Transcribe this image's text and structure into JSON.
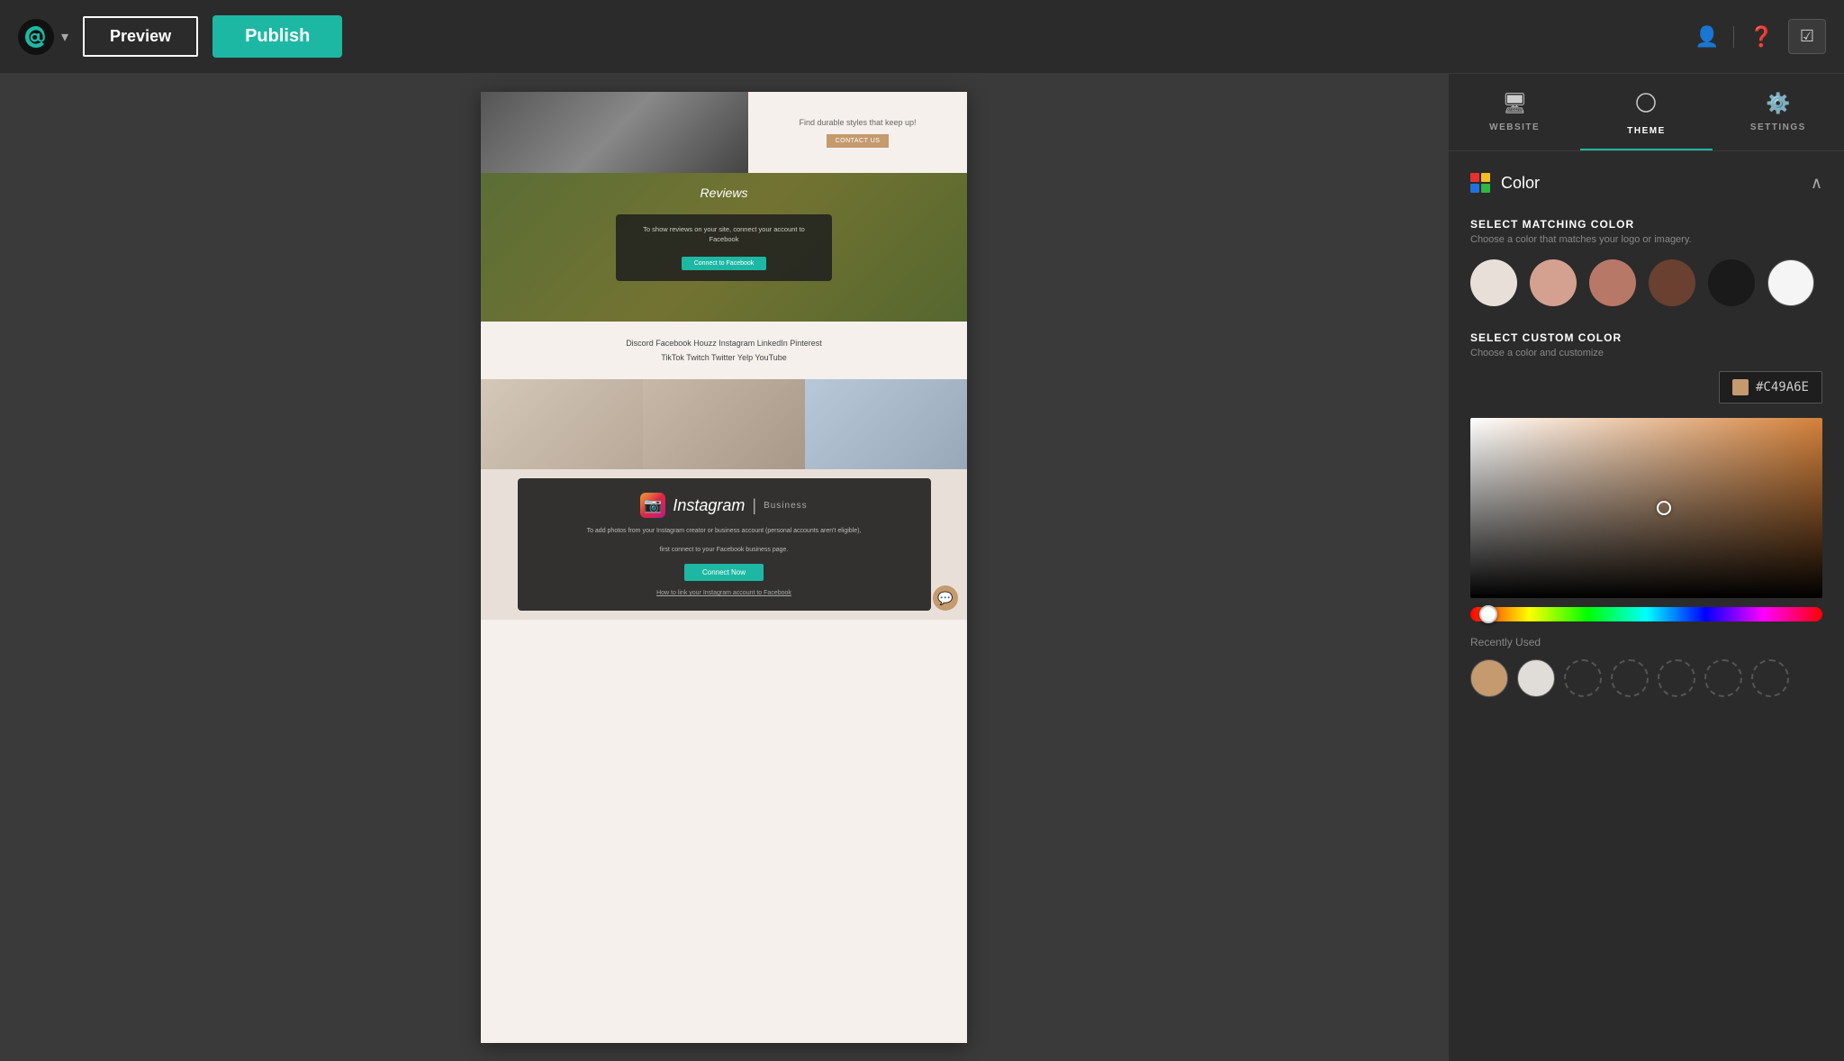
{
  "topbar": {
    "preview_label": "Preview",
    "publish_label": "Publish",
    "logo_alt": "GoDaddy"
  },
  "panel": {
    "tabs": [
      {
        "id": "website",
        "label": "WEBSITE",
        "icon": "🖥"
      },
      {
        "id": "theme",
        "label": "THEME",
        "icon": "◑"
      },
      {
        "id": "settings",
        "label": "SETTINGS",
        "icon": "⚙"
      }
    ],
    "active_tab": "theme",
    "color_section": {
      "title": "Color",
      "select_matching_label": "SELECT MATCHING COLOR",
      "select_matching_sub": "Choose a color that matches your logo or imagery.",
      "matching_colors": [
        "#e8e0d8",
        "#d4a090",
        "#b87868",
        "#6a4030",
        "#1a1a1a",
        "#f5f5f5"
      ],
      "select_custom_label": "SELECT CUSTOM COLOR",
      "select_custom_sub": "Choose a color and customize",
      "custom_hex": "#C49A6E",
      "custom_swatch_color": "#c49a6e",
      "gradient_cursor_left": "55%",
      "gradient_cursor_top": "50%",
      "hue_slider_left": "5%",
      "recently_used_label": "Recently Used",
      "recent_swatches": [
        {
          "color": "#c49a6e",
          "empty": false
        },
        {
          "color": "#e0ddd8",
          "empty": false
        },
        {
          "color": "",
          "empty": true
        },
        {
          "color": "",
          "empty": true
        },
        {
          "color": "",
          "empty": true
        },
        {
          "color": "",
          "empty": true
        },
        {
          "color": "",
          "empty": true
        }
      ]
    }
  },
  "preview": {
    "hero_text": "Find durable styles that keep up!",
    "contact_btn": "CONTACT US",
    "reviews_title": "Reviews",
    "reviews_card_text": "To show reviews on your site, connect your account to Facebook",
    "connect_fb_btn": "Connect to Facebook",
    "social_links_row1": "Discord    Facebook    Houzz    Instagram    LinkedIn    Pinterest",
    "social_links_row2": "TikTok    Twitch    Twitter    Yelp    YouTube",
    "insta_business": "Business",
    "insta_desc1": "To add photos from your Instagram creator or business account (personal accounts aren't eligible),",
    "insta_desc2": "first connect to your Facebook business page.",
    "connect_now_btn": "Connect Now",
    "insta_link_text": "How to link your Instagram account to Facebook"
  }
}
